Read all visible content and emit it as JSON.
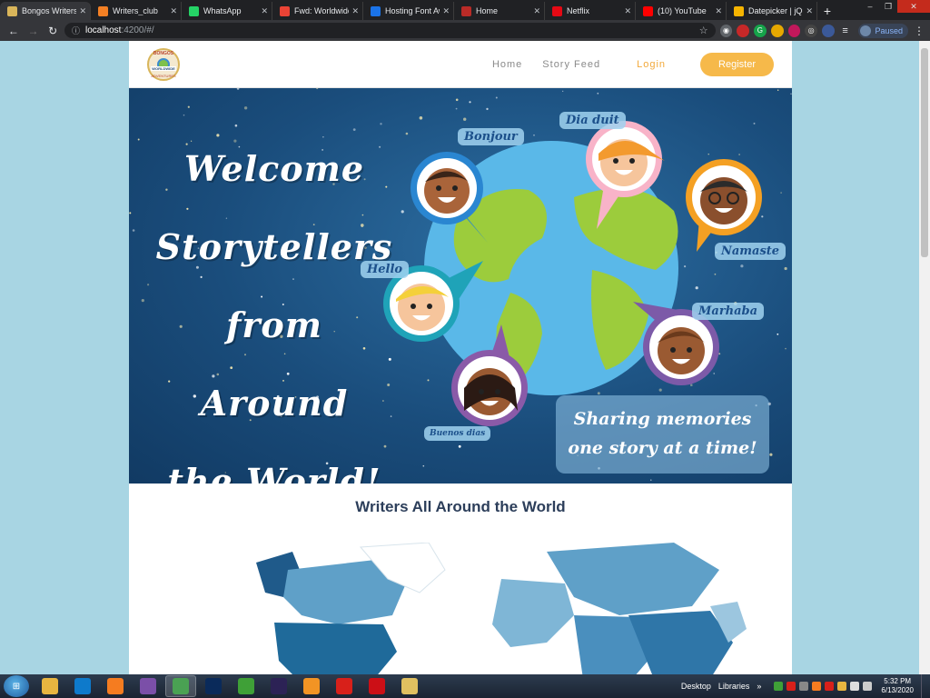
{
  "browser": {
    "tabs": [
      {
        "title": "Bongos Writers C",
        "icon": "bongos-favicon",
        "color": "#d9b55a",
        "active": true
      },
      {
        "title": "Writers_club",
        "icon": "writers-club-favicon",
        "color": "#f48024",
        "active": false
      },
      {
        "title": "WhatsApp",
        "icon": "whatsapp-favicon",
        "color": "#25d366",
        "active": false
      },
      {
        "title": "Fwd: Worldwide",
        "icon": "gmail-favicon",
        "color": "#ea4335",
        "active": false
      },
      {
        "title": "Hosting Font Aw",
        "icon": "font-awesome-favicon",
        "color": "#1a73e8",
        "active": false
      },
      {
        "title": "Home",
        "icon": "quora-favicon",
        "color": "#b92b27",
        "active": false
      },
      {
        "title": "Netflix",
        "icon": "netflix-favicon",
        "color": "#e50914",
        "active": false
      },
      {
        "title": "(10) YouTube",
        "icon": "youtube-favicon",
        "color": "#ff0000",
        "active": false
      },
      {
        "title": "Datepicker | jQue",
        "icon": "jquery-favicon",
        "color": "#f5b400",
        "active": false
      }
    ],
    "url_host": "localhost",
    "url_path": ":4200/#/",
    "profile_status": "Paused"
  },
  "site": {
    "logo": {
      "top": "BONGOS",
      "middle": "WORLDWIDE",
      "bottom": "ADVENTURES"
    },
    "nav": {
      "home": "Home",
      "story_feed": "Story Feed",
      "login": "Login",
      "register": "Register"
    },
    "hero": {
      "headline": [
        "Welcome",
        "Storytellers",
        "from Around",
        "the World!"
      ],
      "greetings": {
        "bonjour": "Bonjour",
        "dia_duit": "Dia duit",
        "namaste": "Namaste",
        "hello": "Hello",
        "marhaba": "Marhaba",
        "buenos_dias": "Buenos dias"
      },
      "tagline": [
        "Sharing memories",
        "one story at a time!"
      ]
    },
    "map_section_title": "Writers All Around the World"
  },
  "taskbar": {
    "apps": [
      {
        "name": "explorer-app",
        "color": "#e8b540"
      },
      {
        "name": "vscode-app",
        "color": "#0e7acb"
      },
      {
        "name": "xampp-app",
        "color": "#f57c20"
      },
      {
        "name": "purple-app",
        "color": "#7b4fa8"
      },
      {
        "name": "chrome-app",
        "color": "#4aa153"
      },
      {
        "name": "photoshop-app",
        "color": "#0a2a5a"
      },
      {
        "name": "mongodb-app",
        "color": "#3fa037"
      },
      {
        "name": "eclipse-app",
        "color": "#2c2255"
      },
      {
        "name": "sublime-app",
        "color": "#f29424"
      },
      {
        "name": "acrobat-app",
        "color": "#d8201a"
      },
      {
        "name": "opera-app",
        "color": "#cc0f16"
      },
      {
        "name": "folder-app",
        "color": "#e0c060"
      }
    ],
    "desktop_label": "Desktop",
    "libraries_label": "Libraries",
    "time": "5:32 PM",
    "date": "6/13/2020"
  }
}
